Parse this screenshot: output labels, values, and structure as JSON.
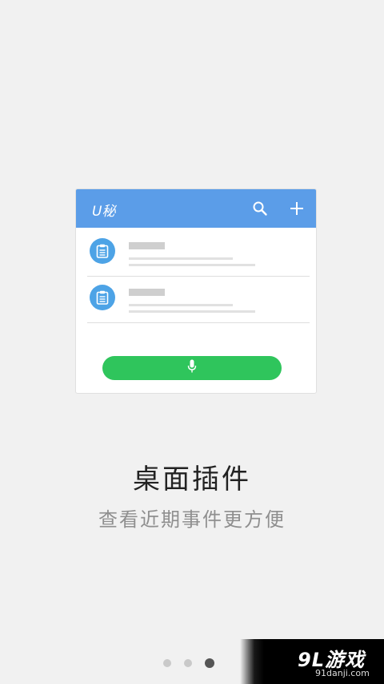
{
  "widget": {
    "title": "U秘",
    "header_icons": [
      "search-icon",
      "plus-icon"
    ],
    "rows": [
      {
        "icon": "clipboard-icon"
      },
      {
        "icon": "clipboard-icon"
      }
    ],
    "voice_button_icon": "microphone-icon"
  },
  "headline": "桌面插件",
  "subline": "查看近期事件更方便",
  "pager": {
    "total": 3,
    "active": 3
  },
  "watermark": {
    "logo": "9L游戏",
    "url": "91danji.com"
  },
  "colors": {
    "background": "#f1f1f1",
    "header_blue": "#5b9de8",
    "icon_blue": "#4da3e6",
    "voice_green": "#2fc55c",
    "dot_active": "#555555",
    "dot_inactive": "#c9c9c9"
  }
}
